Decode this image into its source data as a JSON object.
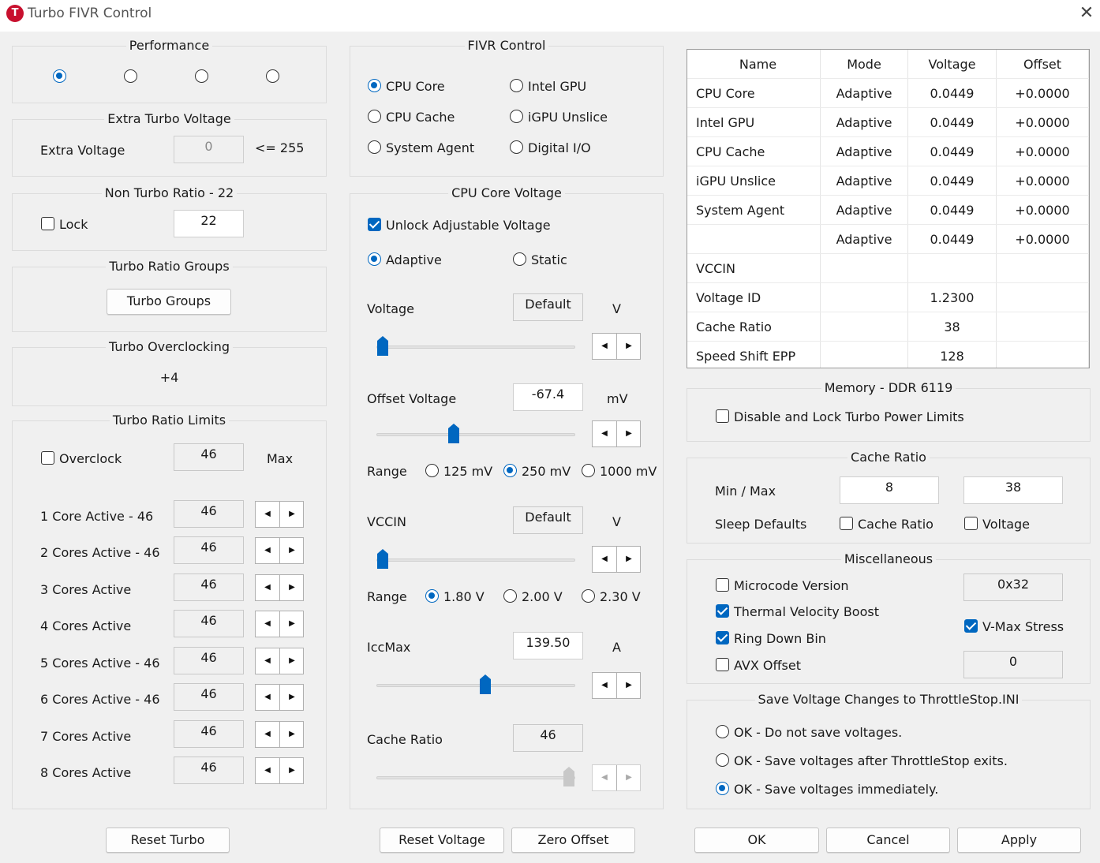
{
  "window": {
    "title": "Turbo FIVR Control",
    "app_icon_letter": "T",
    "close": "✕"
  },
  "performance": {
    "title": "Performance",
    "selected_index": 0,
    "options": 4
  },
  "extra_turbo": {
    "title": "Extra Turbo Voltage",
    "label": "Extra Voltage",
    "value": "0",
    "limit": "<= 255"
  },
  "non_turbo": {
    "title": "Non Turbo Ratio - 22",
    "lock_label": "Lock",
    "lock_checked": false,
    "value": "22"
  },
  "turbo_ratio_groups": {
    "title": "Turbo Ratio Groups",
    "button": "Turbo Groups"
  },
  "turbo_overclocking": {
    "title": "Turbo Overclocking",
    "value": "+4"
  },
  "turbo_ratio_limits": {
    "title": "Turbo Ratio Limits",
    "overclock_label": "Overclock",
    "overclock_checked": false,
    "max_value": "46",
    "max_label": "Max",
    "rows": [
      {
        "label": "1 Core  Active - 46",
        "value": "46"
      },
      {
        "label": "2 Cores Active - 46",
        "value": "46"
      },
      {
        "label": "3 Cores Active",
        "value": "46"
      },
      {
        "label": "4 Cores Active",
        "value": "46"
      },
      {
        "label": "5 Cores Active - 46",
        "value": "46"
      },
      {
        "label": "6 Cores Active - 46",
        "value": "46"
      },
      {
        "label": "7 Cores Active",
        "value": "46"
      },
      {
        "label": "8 Cores Active",
        "value": "46"
      }
    ]
  },
  "fivr_control": {
    "title": "FIVR Control",
    "options": [
      "CPU Core",
      "Intel GPU",
      "CPU Cache",
      "iGPU Unslice",
      "System Agent",
      "Digital I/O"
    ],
    "selected": "CPU Core"
  },
  "cpu_core_voltage": {
    "title": "CPU Core Voltage",
    "unlock_label": "Unlock Adjustable Voltage",
    "unlock_checked": true,
    "mode_adaptive": "Adaptive",
    "mode_static": "Static",
    "mode_selected": "Adaptive",
    "voltage_label": "Voltage",
    "voltage_value": "Default",
    "voltage_unit": "V",
    "offset_label": "Offset Voltage",
    "offset_value": "-67.4",
    "offset_unit": "mV",
    "range_label": "Range",
    "range_options": [
      "125 mV",
      "250 mV",
      "1000 mV"
    ],
    "range_selected": "250 mV",
    "vccin_label": "VCCIN",
    "vccin_value": "Default",
    "vccin_unit": "V",
    "vccin_range_label": "Range",
    "vccin_range_options": [
      "1.80 V",
      "2.00 V",
      "2.30 V"
    ],
    "vccin_range_selected": "1.80 V",
    "iccmax_label": "IccMax",
    "iccmax_value": "139.50",
    "iccmax_unit": "A",
    "cache_ratio_label": "Cache Ratio",
    "cache_ratio_value": "46",
    "slider_levels": {
      "voltage": 0.0,
      "offset": 0.38,
      "vccin": 0.0,
      "iccmax": 0.55,
      "cache_ratio": 1.0
    }
  },
  "table": {
    "headers": [
      "Name",
      "Mode",
      "Voltage",
      "Offset"
    ],
    "rows": [
      [
        "CPU Core",
        "Adaptive",
        "0.0449",
        "+0.0000"
      ],
      [
        "Intel GPU",
        "Adaptive",
        "0.0449",
        "+0.0000"
      ],
      [
        "CPU Cache",
        "Adaptive",
        "0.0449",
        "+0.0000"
      ],
      [
        "iGPU Unslice",
        "Adaptive",
        "0.0449",
        "+0.0000"
      ],
      [
        "System Agent",
        "Adaptive",
        "0.0449",
        "+0.0000"
      ],
      [
        "",
        "Adaptive",
        "0.0449",
        "+0.0000"
      ],
      [
        "VCCIN",
        "",
        "",
        ""
      ],
      [
        "Voltage ID",
        "",
        "1.2300",
        ""
      ],
      [
        "Cache Ratio",
        "",
        "38",
        ""
      ],
      [
        "Speed Shift EPP",
        "",
        "128",
        ""
      ]
    ]
  },
  "memory": {
    "title": "Memory - DDR 6119",
    "disable_lock_label": "Disable and Lock Turbo Power Limits",
    "disable_lock_checked": false
  },
  "cache_ratio": {
    "title": "Cache Ratio",
    "minmax_label": "Min / Max",
    "min": "8",
    "max": "38",
    "sleep_label": "Sleep Defaults",
    "sleep_cache_label": "Cache Ratio",
    "sleep_voltage_label": "Voltage"
  },
  "misc": {
    "title": "Miscellaneous",
    "microcode_label": "Microcode Version",
    "microcode_value": "0x32",
    "tvb_label": "Thermal Velocity Boost",
    "ring_label": "Ring Down Bin",
    "avx_label": "AVX Offset",
    "avx_value": "0",
    "vmax_label": "V-Max Stress"
  },
  "save": {
    "title": "Save Voltage Changes to ThrottleStop.INI",
    "options": [
      "OK - Do not save voltages.",
      "OK - Save voltages after ThrottleStop exits.",
      "OK - Save voltages immediately."
    ],
    "selected_index": 2
  },
  "buttons": {
    "reset_turbo": "Reset Turbo",
    "reset_voltage": "Reset Voltage",
    "zero_offset": "Zero Offset",
    "ok": "OK",
    "cancel": "Cancel",
    "apply": "Apply"
  },
  "colors": {
    "accent": "#0067c0",
    "slider_thumb": "#0067c0",
    "background": "#f0f0f0",
    "app_icon": "#c8102e"
  }
}
